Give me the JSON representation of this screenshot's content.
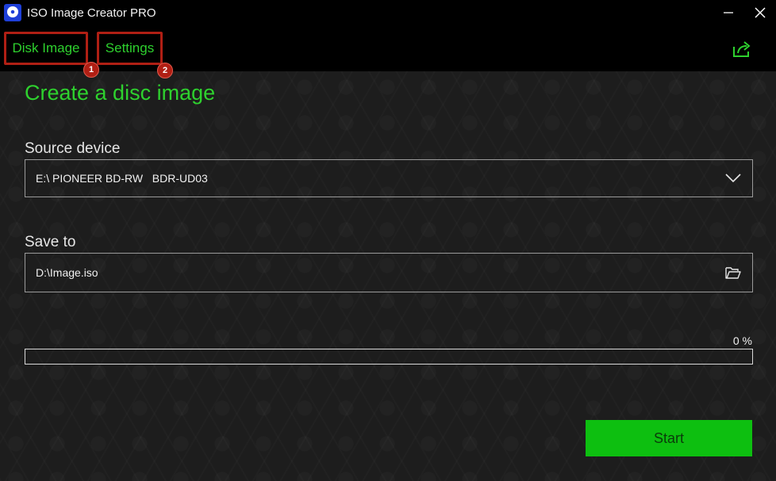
{
  "window": {
    "title": "ISO Image Creator PRO",
    "app_icon": "disc-icon",
    "controls": [
      "minimize-icon",
      "close-icon"
    ]
  },
  "menu": {
    "tabs": [
      {
        "label": "Disk Image",
        "badge": "1"
      },
      {
        "label": "Settings",
        "badge": "2"
      }
    ],
    "share_icon": "share-icon"
  },
  "main": {
    "title": "Create a disc image",
    "source": {
      "label": "Source device",
      "value": "E:\\ PIONEER BD-RW   BDR-UD03",
      "icon": "chevron-down-icon"
    },
    "save": {
      "label": "Save to",
      "value": "D:\\Image.iso",
      "icon": "folder-open-icon"
    },
    "progress": {
      "text": "0 %",
      "value": 0
    },
    "start_label": "Start"
  },
  "colors": {
    "accent": "#2ed12e",
    "start_button": "#0dbf10",
    "highlight_box": "#b01f14"
  }
}
